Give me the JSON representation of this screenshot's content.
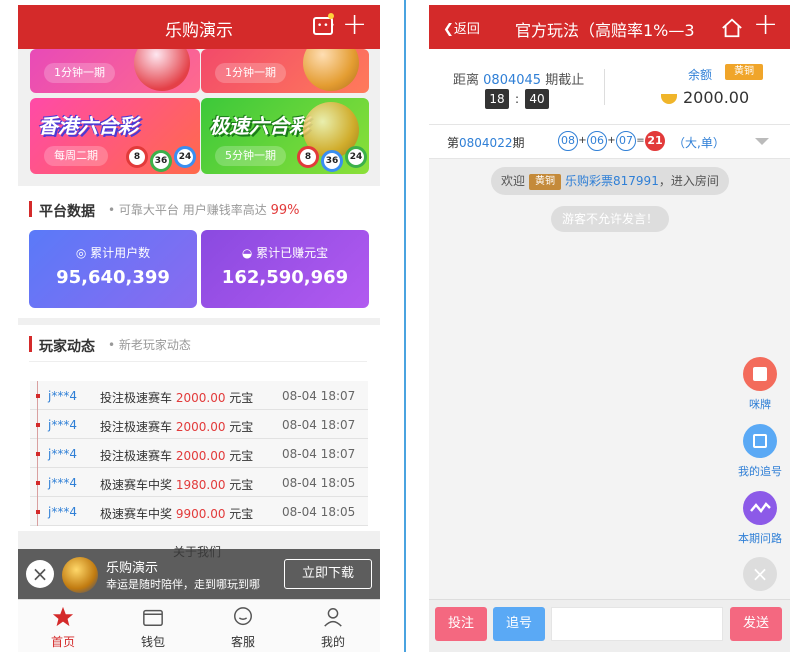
{
  "left": {
    "header": {
      "title": "乐购演示"
    },
    "lotteries": [
      {
        "name": "",
        "freq": "1分钟一期"
      },
      {
        "name": "",
        "freq": "1分钟一期"
      },
      {
        "name": "香港六合彩",
        "freq": "每周二期",
        "balls": [
          "8",
          "36",
          "24"
        ]
      },
      {
        "name": "极速六合彩",
        "freq": "5分钟一期",
        "balls": [
          "8",
          "36",
          "24"
        ]
      }
    ],
    "platform": {
      "title": "平台数据",
      "subtitle": "可靠大平台 用户赚钱率高达",
      "rate": "99%",
      "cards": [
        {
          "label": "累计用户数",
          "value": "95,640,399",
          "color": "#6b6cf6"
        },
        {
          "label": "累计已赚元宝",
          "value": "162,590,969",
          "color": "#9b52e8"
        }
      ]
    },
    "players": {
      "title": "玩家动态",
      "subtitle": "新老玩家动态",
      "rows": [
        {
          "user": "j***4",
          "action": "投注极速赛车",
          "amount": "2000.00",
          "unit": "元宝",
          "time": "08-04 18:07"
        },
        {
          "user": "j***4",
          "action": "投注极速赛车",
          "amount": "2000.00",
          "unit": "元宝",
          "time": "08-04 18:07"
        },
        {
          "user": "j***4",
          "action": "投注极速赛车",
          "amount": "2000.00",
          "unit": "元宝",
          "time": "08-04 18:07"
        },
        {
          "user": "j***4",
          "action": "极速赛车中奖",
          "amount": "1980.00",
          "unit": "元宝",
          "time": "08-04 18:05"
        },
        {
          "user": "j***4",
          "action": "极速赛车中奖",
          "amount": "9900.00",
          "unit": "元宝",
          "time": "08-04 18:05"
        }
      ]
    },
    "footer": {
      "about": "关于我们"
    },
    "download_bar": {
      "app_name": "乐购演示",
      "slogan": "幸运是随时陪伴，走到哪玩到哪",
      "button": "立即下载"
    },
    "tabs": [
      {
        "label": "首页",
        "icon": "star-icon"
      },
      {
        "label": "钱包",
        "icon": "wallet-icon"
      },
      {
        "label": "客服",
        "icon": "chat-icon"
      },
      {
        "label": "我的",
        "icon": "user-icon"
      }
    ]
  },
  "right": {
    "header": {
      "back": "返回",
      "title": "官方玩法（高赔率1%—3"
    },
    "info": {
      "deadline_prefix": "距离",
      "period": "0804045",
      "deadline_suffix": "期截止",
      "minutes": "18",
      "separator": ":",
      "seconds": "40",
      "balance_label": "余额",
      "vip_badge": "黄铜",
      "balance": "2000.00"
    },
    "result": {
      "prefix": "第",
      "period": "0804022",
      "suffix": "期",
      "balls": [
        "08",
        "06",
        "07"
      ],
      "plus": "+",
      "equals": "=",
      "sum": "21",
      "tag": "（大,单）"
    },
    "chat": {
      "welcome_prefix": "欢迎",
      "badge": "黄铜",
      "user": "乐购彩票817991",
      "welcome_suffix": "，进入房间",
      "notice": "游客不允许发言！"
    },
    "fabs": [
      {
        "label": "咪牌",
        "icon": "card-icon",
        "color": "#f36b5b"
      },
      {
        "label": "我的追号",
        "icon": "list-icon",
        "color": "#5aa9f5"
      },
      {
        "label": "本期问路",
        "icon": "trend-icon",
        "color": "#8c5ae8"
      }
    ],
    "bottom": {
      "bet": "投注",
      "follow": "追号",
      "input_placeholder": "",
      "send": "发送"
    }
  }
}
